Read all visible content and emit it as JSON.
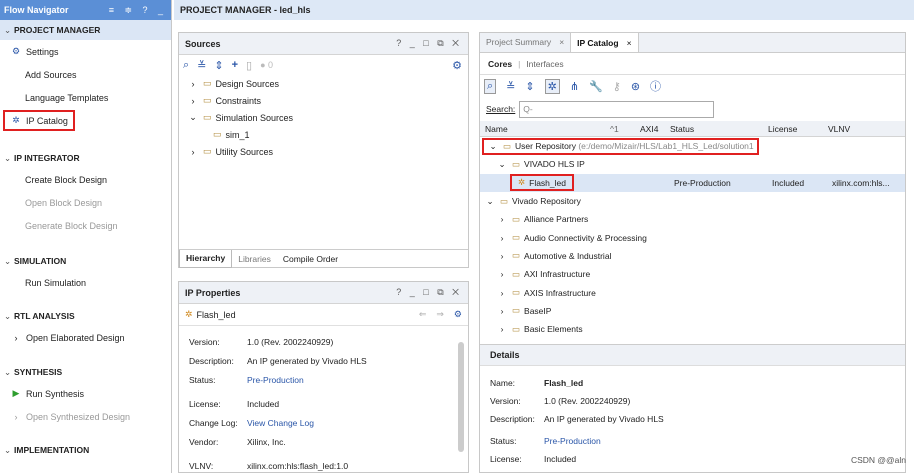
{
  "flow": {
    "title": "Flow Navigator",
    "controls": "≡ ≑ ? _",
    "sections": [
      {
        "label": "PROJECT MANAGER",
        "items": [
          {
            "label": "Settings",
            "dim": false
          },
          {
            "label": "Add Sources",
            "dim": false
          },
          {
            "label": "Language Templates",
            "dim": false
          },
          {
            "label": "IP Catalog",
            "dim": false
          }
        ]
      },
      {
        "label": "IP INTEGRATOR",
        "items": [
          {
            "label": "Create Block Design",
            "dim": false
          },
          {
            "label": "Open Block Design",
            "dim": true
          },
          {
            "label": "Generate Block Design",
            "dim": true
          }
        ]
      },
      {
        "label": "SIMULATION",
        "items": [
          {
            "label": "Run Simulation",
            "dim": false
          }
        ]
      },
      {
        "label": "RTL ANALYSIS",
        "items": [
          {
            "label": "Open Elaborated Design",
            "dim": false
          }
        ]
      },
      {
        "label": "SYNTHESIS",
        "items": [
          {
            "label": "Run Synthesis",
            "dim": false
          },
          {
            "label": "Open Synthesized Design",
            "dim": true
          }
        ]
      },
      {
        "label": "IMPLEMENTATION",
        "items": []
      }
    ]
  },
  "topbar": {
    "title": "PROJECT MANAGER - led_hls"
  },
  "sources": {
    "title": "Sources",
    "controls": "? _ □ ⧉ ✕",
    "count": "0",
    "tree": [
      "Design Sources",
      "Constraints",
      "Simulation Sources",
      "sim_1",
      "Utility Sources"
    ],
    "tabs": [
      "Hierarchy",
      "Libraries",
      "Compile Order"
    ]
  },
  "ipprops": {
    "title": "IP Properties",
    "controls": "? _ □ ⧉ ✕",
    "name": "Flash_led",
    "rows": [
      {
        "k": "Version:",
        "v": "1.0 (Rev. 2002240929)"
      },
      {
        "k": "Description:",
        "v": "An IP generated by Vivado HLS"
      },
      {
        "k": "Status:",
        "v": "Pre-Production"
      },
      {
        "k": "License:",
        "v": "Included"
      },
      {
        "k": "Change Log:",
        "v": "View Change Log"
      },
      {
        "k": "Vendor:",
        "v": "Xilinx, Inc."
      },
      {
        "k": "VLNV:",
        "v": "xilinx.com:hls:flash_led:1.0"
      }
    ]
  },
  "catalog": {
    "tabs": [
      "Project Summary",
      "IP Catalog"
    ],
    "subtabs": [
      "Cores",
      "Interfaces"
    ],
    "search_label": "Search:",
    "search_placeholder": "Q-",
    "columns": [
      "Name",
      "AXI4",
      "Status",
      "License",
      "VLNV"
    ],
    "sort": "^1",
    "user_repo": "User Repository",
    "user_repo_path": "(e:/demo/Mizair/HLS/Lab1_HLS_Led/solution1",
    "vivado_hls": "VIVADO HLS IP",
    "flash": {
      "name": "Flash_led",
      "status": "Pre-Production",
      "license": "Included",
      "vlnv": "xilinx.com:hls..."
    },
    "vivado_repo": "Vivado Repository",
    "folders": [
      "Alliance Partners",
      "Audio Connectivity & Processing",
      "Automotive & Industrial",
      "AXI Infrastructure",
      "AXIS Infrastructure",
      "BaseIP",
      "Basic Elements"
    ]
  },
  "details": {
    "title": "Details",
    "rows": [
      {
        "k": "Name:",
        "v": "Flash_led"
      },
      {
        "k": "Version:",
        "v": "1.0 (Rev. 2002240929)"
      },
      {
        "k": "Description:",
        "v": "An IP generated by Vivado HLS"
      },
      {
        "k": "Status:",
        "v": "Pre-Production"
      },
      {
        "k": "License:",
        "v": "Included"
      }
    ]
  },
  "watermark": "CSDN @@aln"
}
